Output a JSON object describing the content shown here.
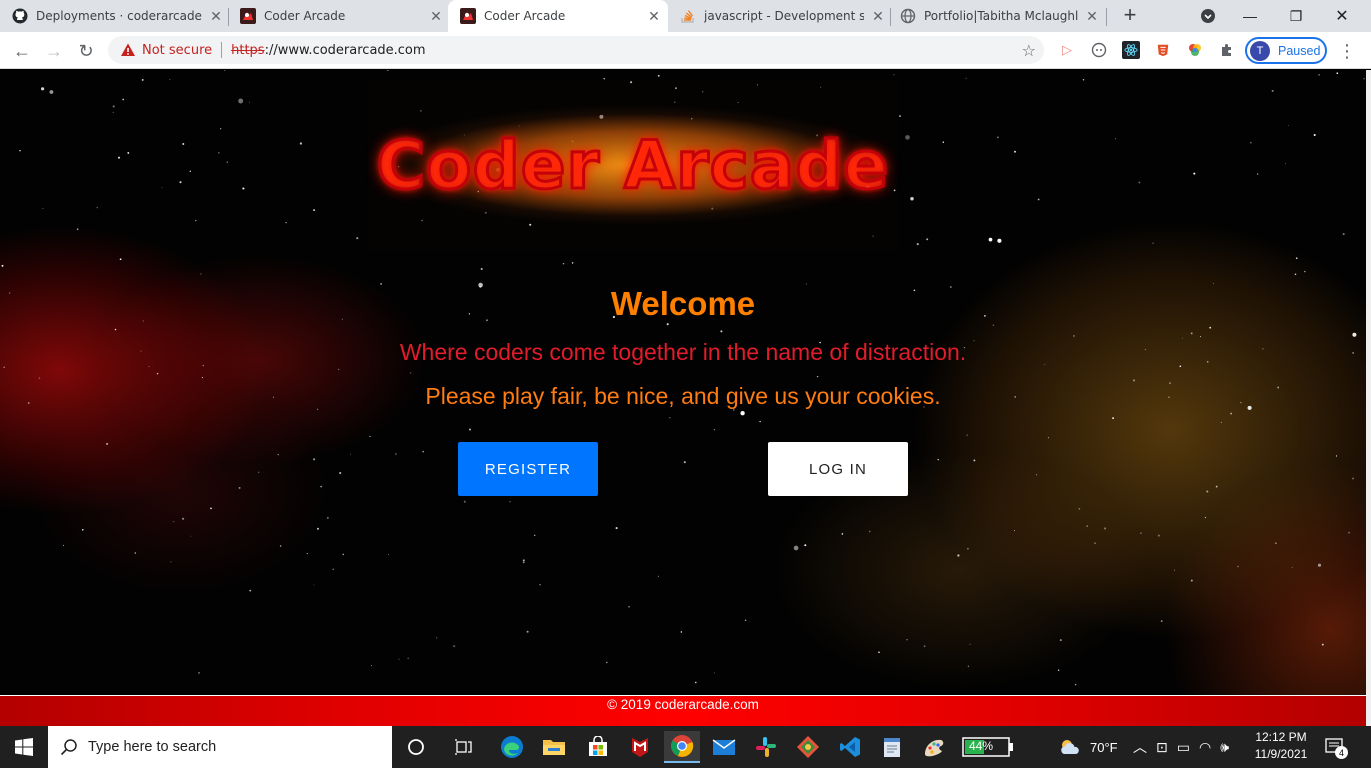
{
  "browser": {
    "tabs": [
      {
        "title": "Deployments · coderarcade/c",
        "favicon": "github-icon"
      },
      {
        "title": "Coder Arcade",
        "favicon": "coder-arcade-icon"
      },
      {
        "title": "Coder Arcade",
        "favicon": "coder-arcade-icon",
        "active": true
      },
      {
        "title": "javascript - Development serv",
        "favicon": "stackoverflow-icon"
      },
      {
        "title": "Portfolio|Tabitha Mclaughlin",
        "favicon": "globe-icon"
      }
    ],
    "address": {
      "security_label": "Not secure",
      "scheme": "https",
      "rest": "://www.coderarcade.com"
    },
    "profile": {
      "initial": "T",
      "label": "Paused"
    }
  },
  "page": {
    "logo": "Coder Arcade",
    "welcome": "Welcome",
    "tagline1": "Where coders come together in the name of distraction.",
    "tagline2": "Please play fair, be nice, and give us your cookies.",
    "register_label": "REGISTER",
    "login_label": "LOG IN",
    "footer": "© 2019 coderarcade.com",
    "colors": {
      "welcome": "#ff7f00",
      "tagline1": "#e21c2a",
      "tagline2": "#ff7c10",
      "register": "#0075ff",
      "footer": "#e00000"
    }
  },
  "taskbar": {
    "search_placeholder": "Type here to search",
    "battery": "44%",
    "weather": "70°F",
    "time": "12:12 PM",
    "date": "11/9/2021",
    "notifications": "4"
  }
}
